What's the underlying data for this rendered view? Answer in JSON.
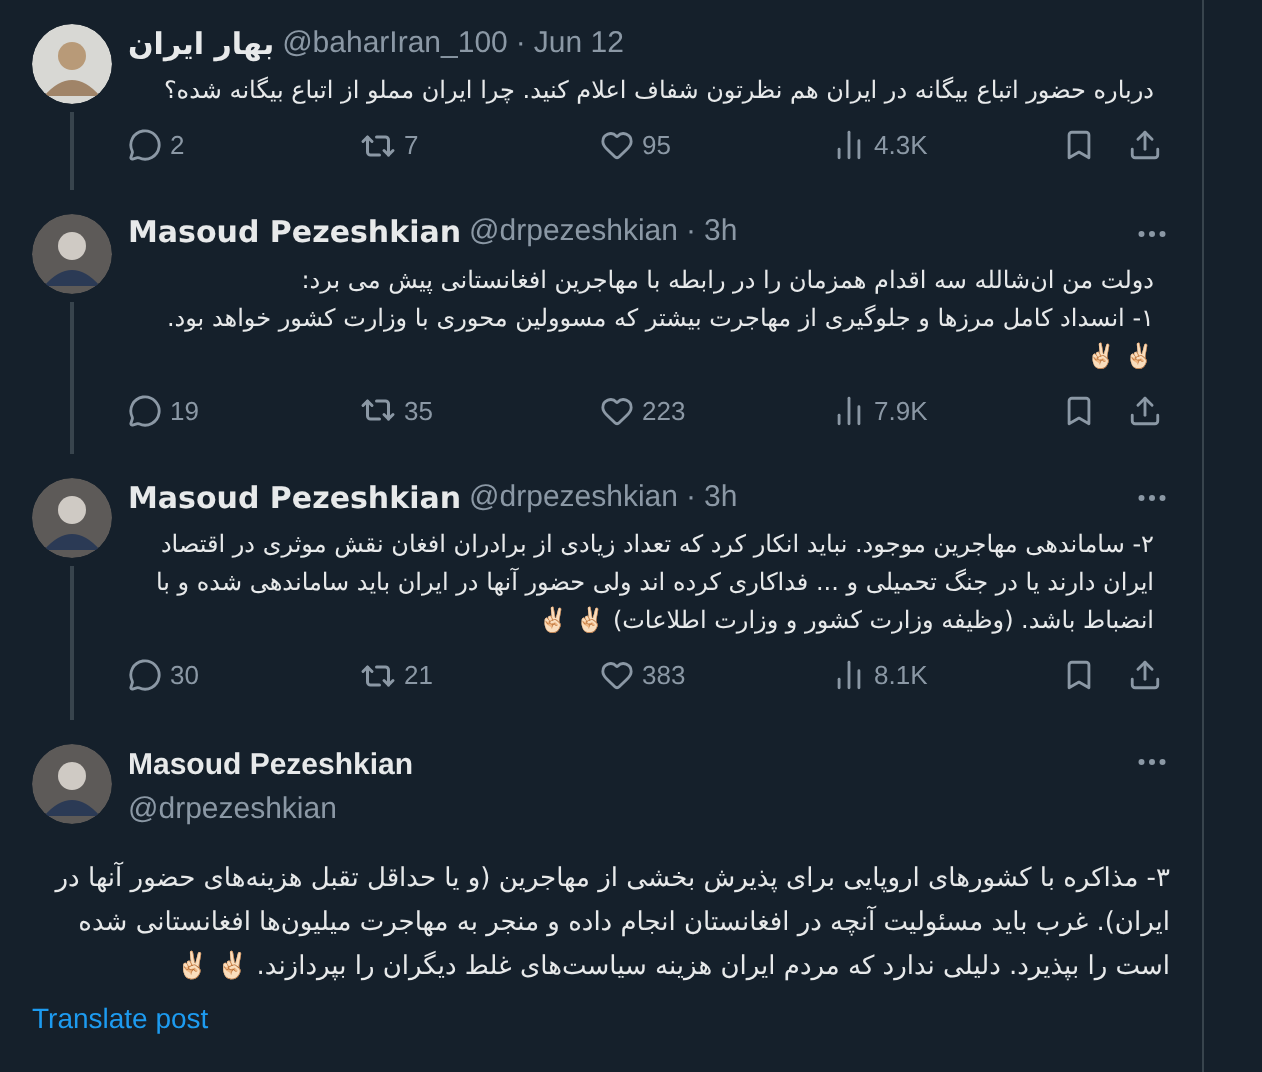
{
  "tweets": [
    {
      "kind": "reply",
      "name": "بهار ایران",
      "handle": "@baharIran_100",
      "dot": "·",
      "time": "Jun 12",
      "menu": false,
      "text": "درباره حضور اتباع بیگانه در ایران هم  نظرتون شفاف اعلام کنید. چرا ایران مملو از اتباع بیگانه شده؟",
      "stats": {
        "replies": "2",
        "reposts": "7",
        "likes": "95",
        "views": "4.3K"
      }
    },
    {
      "kind": "reply",
      "name": "Masoud Pezeshkian",
      "handle": "@drpezeshkian",
      "dot": "·",
      "time": "3h",
      "menu": true,
      "text": "دولت من ان‌شالله سه اقدام همزمان را در رابطه با مهاجرین افغانستانی پیش می برد:\n۱- انسداد کامل مرزها و جلوگیری از مهاجرت بیشتر که مسوولین محوری با وزارت کشور خواهد بود.\n✌🏻 ✌🏻",
      "stats": {
        "replies": "19",
        "reposts": "35",
        "likes": "223",
        "views": "7.9K"
      }
    },
    {
      "kind": "reply",
      "name": "Masoud Pezeshkian",
      "handle": "@drpezeshkian",
      "dot": "·",
      "time": "3h",
      "menu": true,
      "text": "۲- ساماندهی مهاجرین موجود. نباید انکار کرد که تعداد زیادی از برادران افغان نقش موثری در اقتصاد ایران دارند یا در جنگ تحمیلی و ... فداکاری کرده اند ولی حضور آنها در ایران باید ساماندهی شده و با انضباط باشد. (وظیفه وزارت کشور و وزارت اطلاعات) ✌🏻 ✌🏻",
      "stats": {
        "replies": "30",
        "reposts": "21",
        "likes": "383",
        "views": "8.1K"
      }
    },
    {
      "kind": "main",
      "name": "Masoud Pezeshkian",
      "handle": "@drpezeshkian",
      "menu": true,
      "text": "۳- مذاکره با کشورهای اروپایی برای پذیرش بخشی از مهاجرین (و یا حداقل تقبل هزینه‌های حضور آنها در ایران). غرب باید مسئولیت آنچه در افغانستان انجام داده و منجر به مهاجرت میلیون‌ها افغانستانی شده است را بپذیرد. دلیلی ندارد که مردم ایران هزینه سیاست‌های غلط دیگران را بپردازند. ✌🏻 ✌🏻",
      "translate": "Translate post"
    }
  ]
}
